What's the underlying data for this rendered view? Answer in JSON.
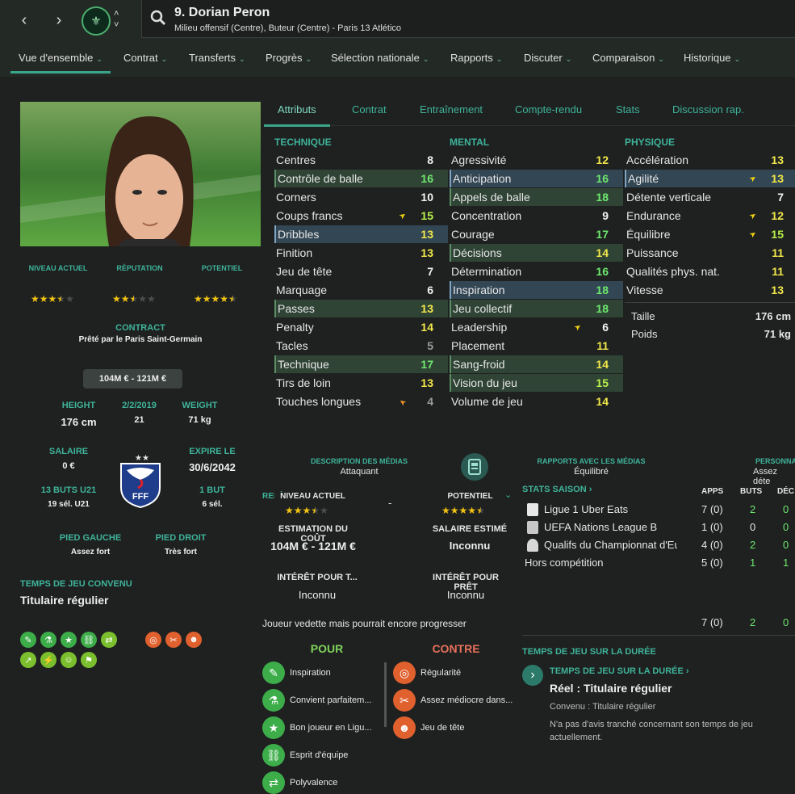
{
  "header": {
    "player_name": "9. Dorian Peron",
    "player_subtitle": "Milieu offensif (Centre), Buteur (Centre) - Paris 13 Atlético",
    "back_icon": "chevron-left-icon",
    "forward_icon": "chevron-right-icon"
  },
  "menu": [
    {
      "label": "Vue d'ensemble"
    },
    {
      "label": "Contrat"
    },
    {
      "label": "Transferts"
    },
    {
      "label": "Progrès"
    },
    {
      "label": "Sélection nationale"
    },
    {
      "label": "Rapports"
    },
    {
      "label": "Discuter"
    },
    {
      "label": "Comparaison"
    },
    {
      "label": "Historique"
    }
  ],
  "profile": {
    "rating_headers": [
      "NIVEAU ACTUEL",
      "RÉPUTATION",
      "POTENTIEL"
    ],
    "ratings_stars": [
      3.5,
      2.5,
      4.5
    ],
    "contract_label": "CONTRACT",
    "contract_value": "Prêté par le Paris Saint-Germain",
    "value_range": "104M € - 121M €",
    "height_label": "HEIGHT",
    "height": "176 cm",
    "dob": "2/2/2019",
    "age": "21",
    "weight_label": "WEIGHT",
    "weight": "71 kg",
    "salary_label": "SALAIRE",
    "salary": "0 €",
    "expires_label": "EXPIRE LE",
    "expires": "30/6/2042",
    "u21_goals_label": "13 BUTS U21",
    "u21_caps": "19 sél. U21",
    "goals_label": "1 BUT",
    "caps": "6 sél.",
    "left_foot_label": "PIED GAUCHE",
    "left_foot": "Assez fort",
    "right_foot_label": "PIED DROIT",
    "right_foot": "Très fort",
    "playing_time_label": "TEMPS DE JEU CONVENU",
    "playing_time": "Titulaire régulier",
    "ffft_text": "FFF"
  },
  "subtabs": [
    "Attributs",
    "Contrat",
    "Entraînement",
    "Compte-rendu",
    "Stats",
    "Discussion rap."
  ],
  "attributes": {
    "technique_title": "TECHNIQUE",
    "mental_title": "MENTAL",
    "physique_title": "PHYSIQUE",
    "technique": [
      {
        "name": "Centres",
        "value": "8"
      },
      {
        "name": "Contrôle de balle",
        "value": "16"
      },
      {
        "name": "Corners",
        "value": "10"
      },
      {
        "name": "Coups francs",
        "value": "15"
      },
      {
        "name": "Dribbles",
        "value": "13"
      },
      {
        "name": "Finition",
        "value": "13"
      },
      {
        "name": "Jeu de tête",
        "value": "7"
      },
      {
        "name": "Marquage",
        "value": "6"
      },
      {
        "name": "Passes",
        "value": "13"
      },
      {
        "name": "Penalty",
        "value": "14"
      },
      {
        "name": "Tacles",
        "value": "5"
      },
      {
        "name": "Technique",
        "value": "17"
      },
      {
        "name": "Tirs de loin",
        "value": "13"
      },
      {
        "name": "Touches longues",
        "value": "4"
      }
    ],
    "mental": [
      {
        "name": "Agressivité",
        "value": "12"
      },
      {
        "name": "Anticipation",
        "value": "16"
      },
      {
        "name": "Appels de balle",
        "value": "18"
      },
      {
        "name": "Concentration",
        "value": "9"
      },
      {
        "name": "Courage",
        "value": "17"
      },
      {
        "name": "Décisions",
        "value": "14"
      },
      {
        "name": "Détermination",
        "value": "16"
      },
      {
        "name": "Inspiration",
        "value": "18"
      },
      {
        "name": "Jeu collectif",
        "value": "18"
      },
      {
        "name": "Leadership",
        "value": "6"
      },
      {
        "name": "Placement",
        "value": "11"
      },
      {
        "name": "Sang-froid",
        "value": "14"
      },
      {
        "name": "Vision du jeu",
        "value": "15"
      },
      {
        "name": "Volume de jeu",
        "value": "14"
      }
    ],
    "physique": [
      {
        "name": "Accélération",
        "value": "13"
      },
      {
        "name": "Agilité",
        "value": "13"
      },
      {
        "name": "Détente verticale",
        "value": "7"
      },
      {
        "name": "Endurance",
        "value": "12"
      },
      {
        "name": "Équilibre",
        "value": "15"
      },
      {
        "name": "Puissance",
        "value": "11"
      },
      {
        "name": "Qualités phys. nat.",
        "value": "11"
      },
      {
        "name": "Vitesse",
        "value": "13"
      }
    ],
    "height_label": "Taille",
    "height_value": "176 cm",
    "weight_label": "Poids",
    "weight_value": "71 kg"
  },
  "media": {
    "desc_label": "DESCRIPTION DES MÉDIAS",
    "desc_value": "Attaquant",
    "relations_label": "RAPPORTS AVEC LES MÉDIAS",
    "relations_value": "Équilibré",
    "personal_label": "PERSONNA",
    "personal_value": "Assez déte"
  },
  "scout": {
    "rep_label": "REPÈRE",
    "current_label": "NIVEAU ACTUEL",
    "current_stars": 3.5,
    "dash": "-",
    "potential_label": "POTENTIEL",
    "potential_stars": 4.5,
    "cost_label": "ESTIMATION DU COÛT",
    "cost_value": "104M € - 121M €",
    "salary_label": "SALAIRE ESTIMÉ",
    "salary_value": "Inconnu",
    "transfer_interest_label": "INTÉRÊT POUR T...",
    "transfer_interest_value": "Inconnu",
    "loan_interest_label": "INTÉRÊT POUR PRÊT",
    "loan_interest_value": "Inconnu",
    "summary": "Joueur vedette mais pourrait encore progresser"
  },
  "pros_cons": {
    "pros_title": "POUR",
    "cons_title": "CONTRE",
    "pros": [
      {
        "label": "Inspiration",
        "icon": "pen-icon"
      },
      {
        "label": "Convient parfaitem...",
        "icon": "flask-icon"
      },
      {
        "label": "Bon joueur en Ligu...",
        "icon": "star-icon"
      },
      {
        "label": "Esprit d'équipe",
        "icon": "link-icon"
      },
      {
        "label": "Polyvalence",
        "icon": "swap-icon"
      }
    ],
    "cons": [
      {
        "label": "Régularité",
        "icon": "target-icon"
      },
      {
        "label": "Assez médiocre dans...",
        "icon": "broken-pen-icon"
      },
      {
        "label": "Jeu de tête",
        "icon": "head-icon"
      }
    ]
  },
  "season_stats": {
    "title": "STATS SAISON",
    "col_apps": "APPS",
    "col_goals": "BUTS",
    "col_dec": "DÉC",
    "rows": [
      {
        "competition": "Ligue 1 Uber Eats",
        "apps": "7 (0)",
        "goals": "2",
        "dec": "0"
      },
      {
        "competition": "UEFA Nations League B",
        "apps": "1 (0)",
        "goals": "0",
        "dec": "0"
      },
      {
        "competition": "Qualifs du Championnat d'Eu...",
        "apps": "4 (0)",
        "goals": "2",
        "dec": "0"
      },
      {
        "competition": "Hors compétition",
        "apps": "5 (0)",
        "goals": "1",
        "dec": "1"
      }
    ],
    "total_apps": "7 (0)",
    "total_goals": "2",
    "total_dec": "0"
  },
  "playing_time": {
    "section_title": "TEMPS DE JEU SUR LA DURÉE",
    "link_title": "TEMPS DE JEU SUR LA DURÉE",
    "real_text": "Réel : Titulaire régulier",
    "agreed_text": "Convenu : Titulaire régulier",
    "note": "N'a pas d'avis tranché concernant son temps de jeu actuellement."
  },
  "colors": {
    "accent": "#3fb39a",
    "star": "#f2c314",
    "background": "#1e2120"
  }
}
